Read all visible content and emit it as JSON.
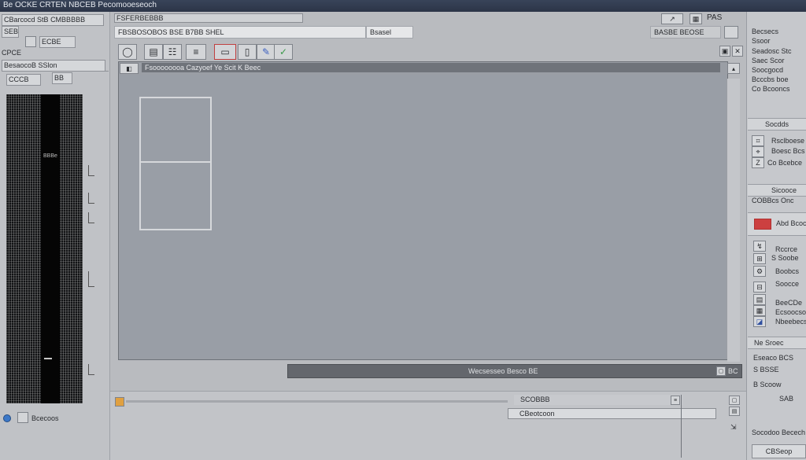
{
  "window": {
    "title": "Be OCKE CRTEN NBCEB Pecomooeseoch"
  },
  "left_panel": {
    "row1_chip": "CBarcocd",
    "row1_suffix": "StB",
    "row1_tail": "CMBBBBB",
    "row2_chip": "SEBS",
    "row2_tag": "ECBE",
    "row3": "CPCE",
    "row4": "BesaocoB SSlon",
    "row5_a": "CCCB",
    "row5_b": "BB",
    "wave_label": "BBBe",
    "status_text": "Bcecoos"
  },
  "top": {
    "path": "FSFERBEBBB",
    "tabs": [
      "FBSBOSOBOS BSE B7BB SHEL",
      "Bsasel"
    ],
    "right_tab": "BASBE BEOSE",
    "right_btns": [
      "PAS"
    ]
  },
  "canvas": {
    "header": "Fsoooooooa Cazyoef Ye Scit K Beec"
  },
  "timeline": {
    "label": "Wecsesseo Besco BE",
    "end": "BC"
  },
  "bottom": {
    "row_a": "SCOBBB",
    "row_b": "CBeotcoon"
  },
  "right_panel": {
    "lines_top": [
      "Becsecs",
      "Ssoor",
      "Seadosc Stc",
      "Saec Scor",
      "Soocgocd",
      "Bcccbs boe",
      "Co Bcooncs"
    ],
    "section1": "Socdds",
    "s1_items": [
      "Rsclboese",
      "Boesc Bcs",
      "Co Bcebce"
    ],
    "section2_a": "Sicooce",
    "section2_b": "COBBcs Onc",
    "section3": "Abd Bcoce",
    "s3_items": [
      "Rccrce",
      "S Soobe",
      "Boobcs",
      "Soocce"
    ],
    "s4_items": [
      "BeeCDe",
      "Ecsoocso",
      "Nbeebecs"
    ],
    "tail": [
      "Ne Sroec",
      "Eseaco BCS",
      "S BSSE",
      "B Scoow",
      "SAB"
    ],
    "footer_label": "Socodoo Becech",
    "footer_btn": "CBSeop"
  }
}
